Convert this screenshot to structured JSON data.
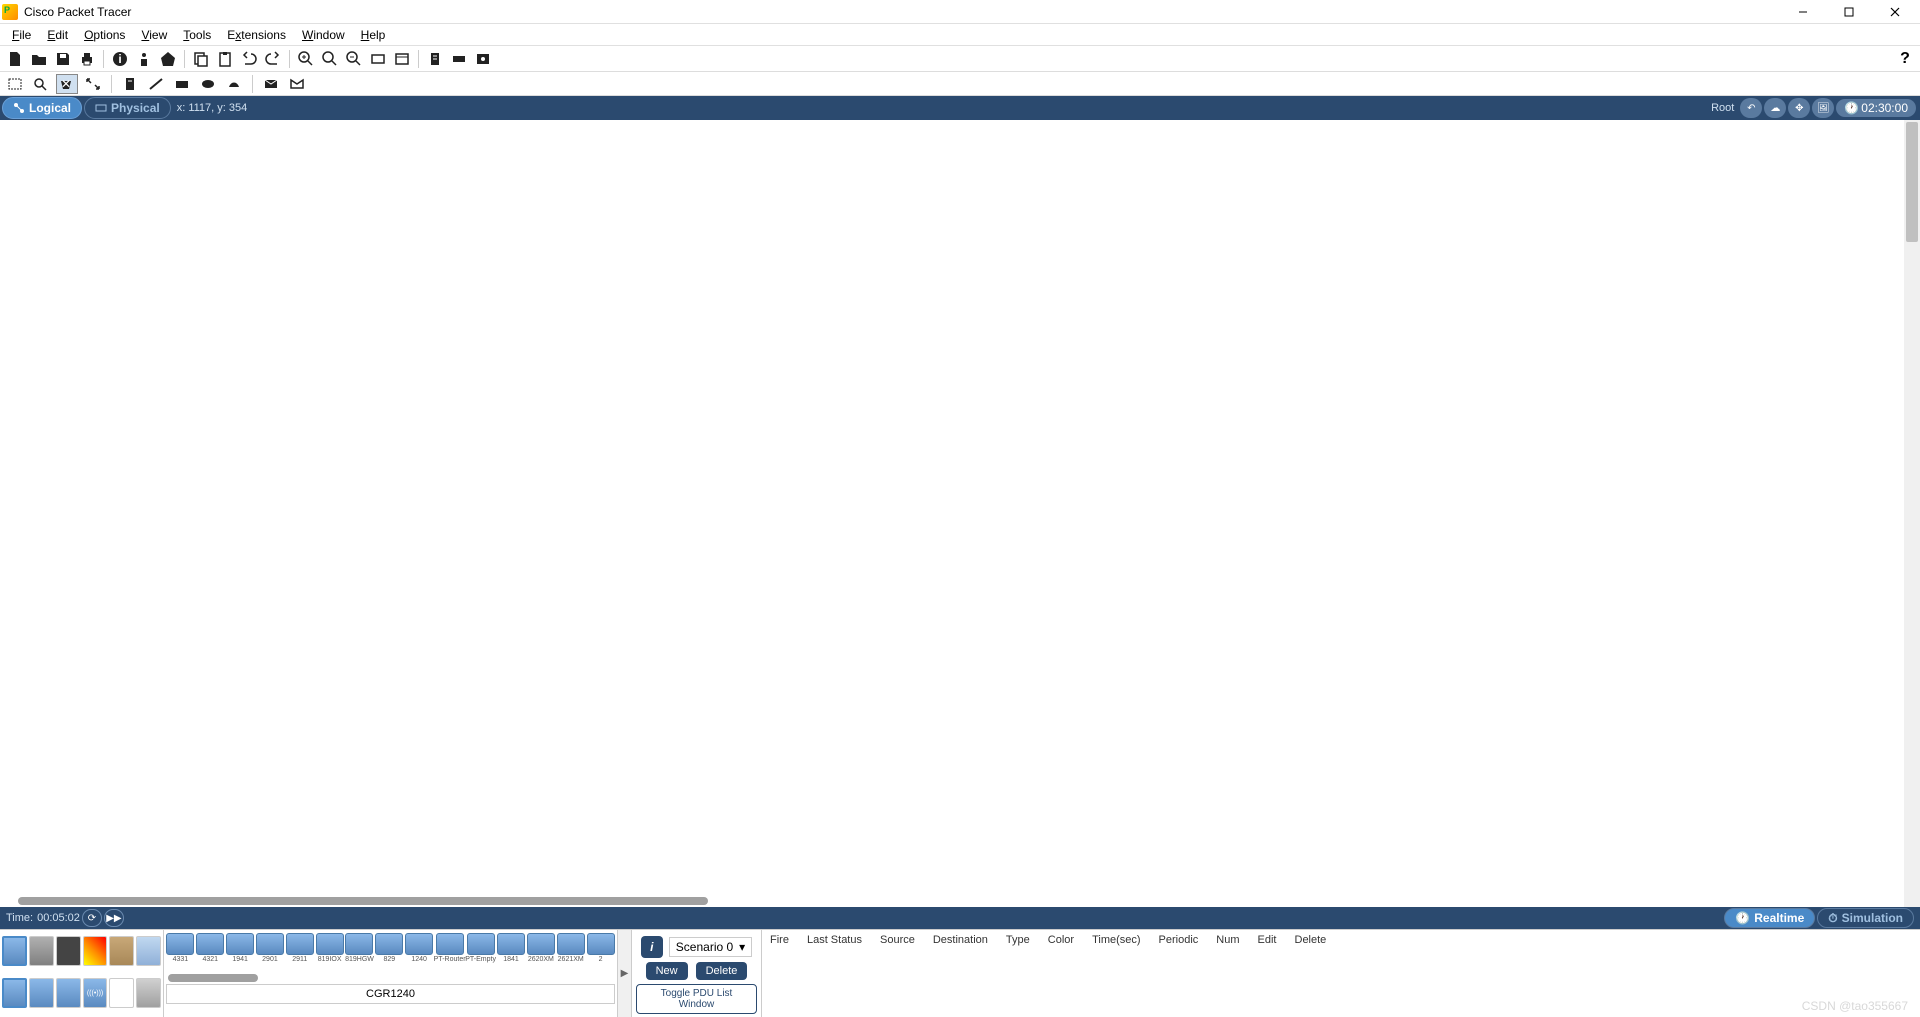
{
  "window": {
    "title": "Cisco Packet Tracer"
  },
  "menu": {
    "file": "File",
    "edit": "Edit",
    "options": "Options",
    "view": "View",
    "tools": "Tools",
    "extensions": "Extensions",
    "window": "Window",
    "help": "Help"
  },
  "viewbar": {
    "logical": "Logical",
    "physical": "Physical",
    "root": "Root",
    "coords": "x: 1117, y: 354",
    "clock": "02:30:00"
  },
  "timebar": {
    "label": "Time:",
    "value": "00:05:02",
    "realtime": "Realtime",
    "simulation": "Simulation"
  },
  "scenario": {
    "selected": "Scenario 0",
    "new": "New",
    "delete": "Delete",
    "toggle": "Toggle PDU List Window"
  },
  "pdu_headers": {
    "fire": "Fire",
    "last_status": "Last Status",
    "source": "Source",
    "destination": "Destination",
    "type": "Type",
    "color": "Color",
    "time": "Time(sec)",
    "periodic": "Periodic",
    "num": "Num",
    "edit": "Edit",
    "delete": "Delete"
  },
  "devices": {
    "list": [
      {
        "label": "4331"
      },
      {
        "label": "4321"
      },
      {
        "label": "1941"
      },
      {
        "label": "2901"
      },
      {
        "label": "2911"
      },
      {
        "label": "819IOX"
      },
      {
        "label": "819HGW"
      },
      {
        "label": "829"
      },
      {
        "label": "1240"
      },
      {
        "label": "PT-Router"
      },
      {
        "label": "PT-Empty"
      },
      {
        "label": "1841"
      },
      {
        "label": "2620XM"
      },
      {
        "label": "2621XM"
      },
      {
        "label": "2"
      }
    ],
    "selected_name": "CGR1240"
  },
  "watermark": "CSDN @tao355667"
}
